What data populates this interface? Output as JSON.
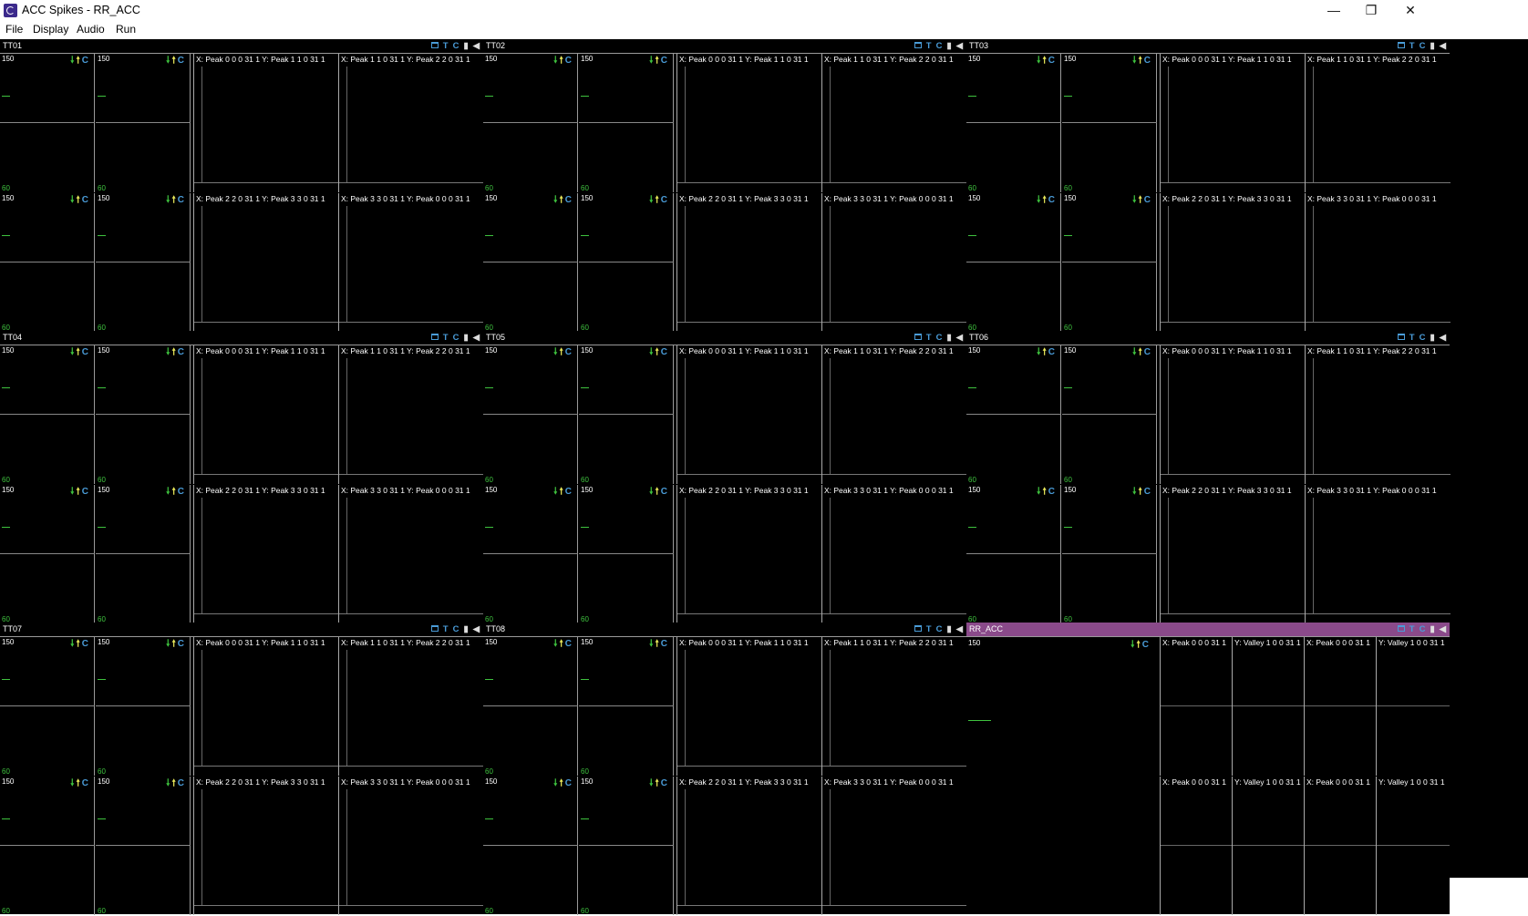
{
  "window": {
    "title": "ACC Spikes - RR_ACC",
    "minimize": "—",
    "restore": "❐",
    "close": "✕"
  },
  "menu": [
    "File",
    "Display",
    "Audio",
    "Run"
  ],
  "tetrodes": [
    {
      "name": "TT01"
    },
    {
      "name": "TT02"
    },
    {
      "name": "TT03"
    },
    {
      "name": "TT04"
    },
    {
      "name": "TT05"
    },
    {
      "name": "TT06"
    },
    {
      "name": "TT07"
    },
    {
      "name": "TT08"
    }
  ],
  "waveform": {
    "max": "150",
    "min": "60",
    "down": "🠗",
    "up": "🠕",
    "clear": "C"
  },
  "header_icons": {
    "t": "T",
    "c": "C",
    "pause": "▮",
    "speaker": "◀"
  },
  "cluster_labels": {
    "row1": [
      "X: Peak 0 0 0 31 1  Y: Peak 1 1 0 31 1",
      "X: Peak 1 1 0 31 1  Y: Peak 2 2 0 31 1"
    ],
    "row2": [
      "X: Peak 2 2 0 31 1  Y: Peak 3 3 0 31 1",
      "X: Peak 3 3 0 31 1  Y: Peak 0 0 0 31 1"
    ]
  },
  "acc": {
    "name": "RR_ACC",
    "max": "150",
    "labels": [
      "X: Peak 0 0 0 31 1",
      "Y: Valley 1 0 0 31 1",
      "X: Peak 0 0 0 31 1",
      "Y: Valley 1 0 0 31 1"
    ]
  },
  "colors": {
    "background": "#000000",
    "acc_header": "#8a4a8a",
    "min_label": "#3ec23e",
    "icon_blue": "#4a9cd8"
  }
}
